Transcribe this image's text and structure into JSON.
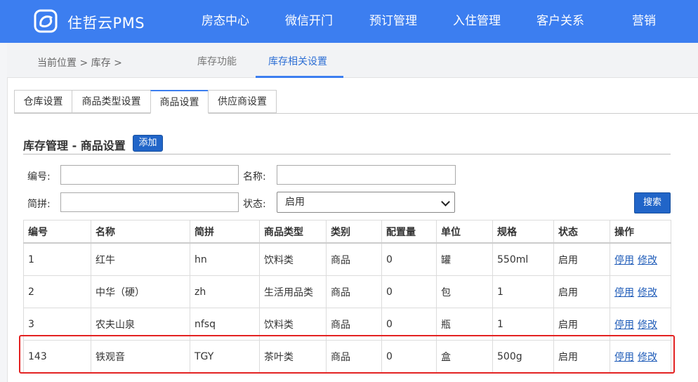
{
  "app": {
    "brand": "住哲云PMS"
  },
  "nav": {
    "items": [
      "房态中心",
      "微信开门",
      "预订管理",
      "入住管理",
      "客户关系",
      "营销"
    ]
  },
  "breadcrumb": {
    "text": "当前位置 > 库存 >",
    "tabs": [
      "库存功能",
      "库存相关设置"
    ],
    "active_tab": "库存相关设置"
  },
  "subtabs": {
    "items": [
      "仓库设置",
      "商品类型设置",
      "商品设置",
      "供应商设置"
    ],
    "active": "商品设置"
  },
  "section": {
    "title": "库存管理 - 商品设置",
    "add_label": "添加"
  },
  "form": {
    "code_label": "编号:",
    "code_value": "",
    "name_label": "名称:",
    "name_value": "",
    "pinyin_label": "简拼:",
    "pinyin_value": "",
    "status_label": "状态:",
    "status_value": "启用",
    "search_label": "搜索"
  },
  "table": {
    "headers": [
      "编号",
      "名称",
      "简拼",
      "商品类型",
      "类别",
      "配置量",
      "单位",
      "规格",
      "状态",
      "操作"
    ],
    "rows": [
      {
        "id": "1",
        "name": "红牛",
        "pinyin": "hn",
        "type": "饮料类",
        "category": "商品",
        "quantity": "0",
        "unit": "罐",
        "spec": "550ml",
        "status": "启用",
        "disable": "停用",
        "edit": "修改"
      },
      {
        "id": "2",
        "name": "中华（硬）",
        "pinyin": "zh",
        "type": "生活用品类",
        "category": "商品",
        "quantity": "0",
        "unit": "包",
        "spec": "1",
        "status": "启用",
        "disable": "停用",
        "edit": "修改"
      },
      {
        "id": "3",
        "name": "农夫山泉",
        "pinyin": "nfsq",
        "type": "饮料类",
        "category": "商品",
        "quantity": "0",
        "unit": "瓶",
        "spec": "1",
        "status": "启用",
        "disable": "停用",
        "edit": "修改"
      },
      {
        "id": "143",
        "name": "铁观音",
        "pinyin": "TGY",
        "type": "茶叶类",
        "category": "商品",
        "quantity": "0",
        "unit": "盒",
        "spec": "500g",
        "status": "启用",
        "disable": "停用",
        "edit": "修改"
      }
    ]
  },
  "colors": {
    "nav_bg": "#3c7ef0",
    "button_bg": "#2165c8",
    "link": "#1e5bb8",
    "highlight": "#e32222"
  }
}
